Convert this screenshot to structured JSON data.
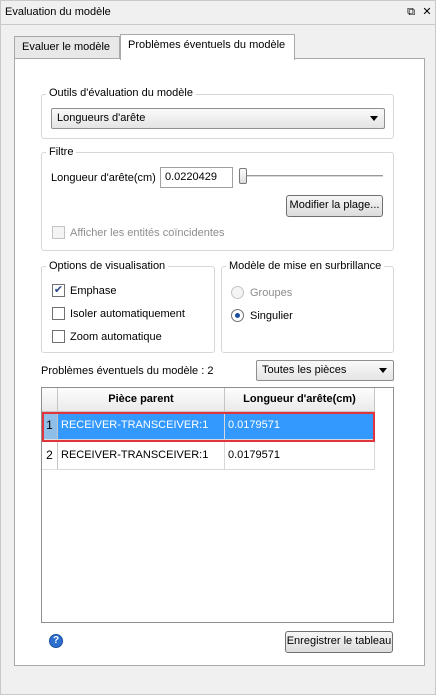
{
  "window": {
    "title": "Evaluation du modèle",
    "float_icon": "⧉",
    "close_icon": "✕"
  },
  "tabs": [
    {
      "label": "Evaluer le modèle",
      "active": false
    },
    {
      "label": "Problèmes éventuels du modèle",
      "active": true
    }
  ],
  "tools": {
    "group_title": "Outils d'évaluation du modèle",
    "selected": "Longueurs d'arête"
  },
  "filter": {
    "group_title": "Filtre",
    "length_label": "Longueur d'arête(cm)",
    "length_value": "0.0220429",
    "slider_level": 0,
    "modify_range_label": "Modifier la plage...",
    "show_coincident_label": "Afficher les entités coïncidentes",
    "show_coincident_checked": false,
    "show_coincident_enabled": false
  },
  "display_options": {
    "group_title": "Options de visualisation",
    "emphasis_label": "Emphase",
    "emphasis_checked": true,
    "auto_isolate_label": "Isoler automatiquement",
    "auto_isolate_checked": false,
    "auto_zoom_label": "Zoom automatique",
    "auto_zoom_checked": false
  },
  "highlight_model": {
    "group_title": "Modèle de mise en surbrillance",
    "groups_label": "Groupes",
    "groups_enabled": false,
    "single_label": "Singulier",
    "selected": "Singulier"
  },
  "issues": {
    "count_label": "Problèmes éventuels du modèle : 2",
    "scope_selected": "Toutes les pièces",
    "columns": [
      "Pièce parent",
      "Longueur d'arête(cm)"
    ],
    "rows": [
      {
        "index": "1",
        "parent": "RECEIVER-TRANSCEIVER:1",
        "length": "0.0179571",
        "selected": true
      },
      {
        "index": "2",
        "parent": "RECEIVER-TRANSCEIVER:1",
        "length": "0.0179571",
        "selected": false
      }
    ]
  },
  "footer": {
    "help_icon": "?",
    "save_table_label": "Enregistrer le tableau"
  },
  "colors": {
    "selection": "#3399ff",
    "selection_outline": "#e2343b",
    "row_header_selected": "#8fbfe8"
  }
}
